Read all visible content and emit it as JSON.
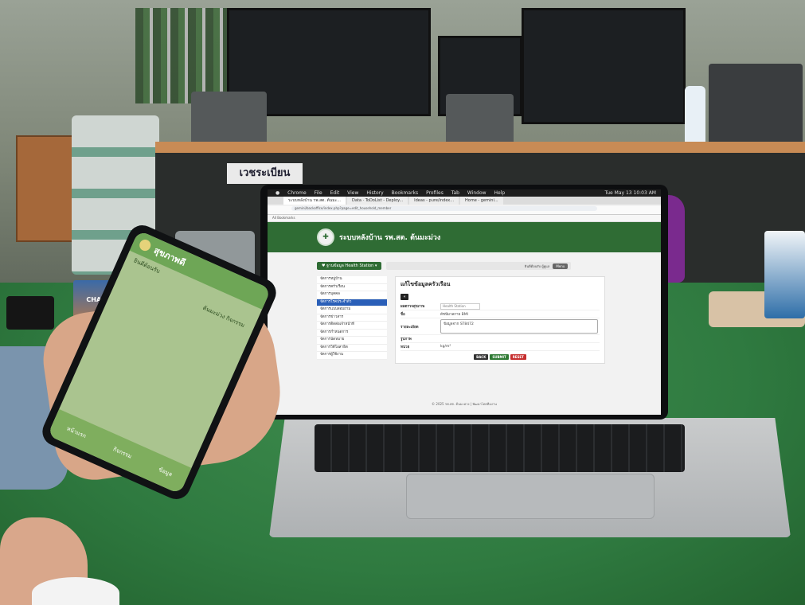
{
  "background": {
    "poster_text": "เวชระเบียน",
    "juice_box_brand": "CHABAA"
  },
  "browser": {
    "menubar": [
      "Chrome",
      "File",
      "Edit",
      "View",
      "History",
      "Bookmarks",
      "Profiles",
      "Tab",
      "Window",
      "Help"
    ],
    "menubar_time": "Tue May 13 10:03 AM",
    "tabs": [
      {
        "label": "ระบบหลังบ้าน รพ.สต. ต้นมะ...",
        "active": true
      },
      {
        "label": "Data · ToDoList - Deploy..."
      },
      {
        "label": "Ideas - pure/index..."
      },
      {
        "label": "Home - gemini..."
      }
    ],
    "url": "gemini/backoffice/index.php?page=edit_household_member",
    "bookmarks": "All Bookmarks"
  },
  "app": {
    "title": "ระบบหลังบ้าน รพ.สต. ต้นมะม่วง",
    "health_station_button": "ฐานข้อมูล Health Station",
    "welcome_text": "ยินดีต้อนรับ ผู้ดูแล",
    "menu_label": "Menu",
    "sidebar": [
      {
        "label": "จัดการหมู่บ้าน"
      },
      {
        "label": "จัดการครัวเรือน"
      },
      {
        "label": "จัดการบุคคล"
      },
      {
        "label": "จัดการโรคประจำตัว",
        "active": true
      },
      {
        "label": "จัดการแบบสอบถาม"
      },
      {
        "label": "จัดการข่าวสาร"
      },
      {
        "label": "จัดการติดต่อเจ้าหน้าที่"
      },
      {
        "label": "จัดการกำหนดการ"
      },
      {
        "label": "จัดการนัดหมาย"
      },
      {
        "label": "จัดการวิดีโอสาธิต"
      },
      {
        "label": "จัดการผู้ใช้งาน"
      }
    ],
    "form": {
      "title": "แก้ไขข้อมูลครัวเรือน",
      "back_icon": "«",
      "rows": [
        {
          "label": "ผลตรวจสุขภาพ",
          "value": "Health Station",
          "type": "select"
        },
        {
          "label": "ชื่อ",
          "value": "ดัชนีมวลกาย BMI",
          "type": "text"
        },
        {
          "label": "รายละเอียด",
          "value": "ข้อมูลจาก ST8472",
          "type": "textarea"
        },
        {
          "label": "รูปภาพ",
          "value": "",
          "type": "text"
        },
        {
          "label": "หน่วย",
          "value": "kg/m²",
          "type": "text"
        }
      ],
      "buttons": {
        "back": "BACK",
        "submit": "SUBMIT",
        "reset": "RESET"
      }
    },
    "footer": "© 2025 รพ.สต. ต้นมะม่วง | พัฒนาโดยทีมงาน"
  },
  "phone": {
    "title": "สุขภาพดี ",
    "line1": "ยินดีต้อนรับ",
    "user": "ต้นมะม่วง กิจกรรม",
    "nav": [
      "หน้าแรก",
      "กิจกรรม",
      "ข้อมูล"
    ]
  }
}
